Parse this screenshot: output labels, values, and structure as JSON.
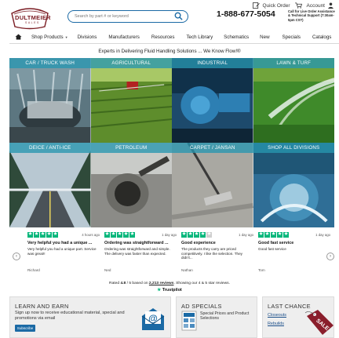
{
  "utility": {
    "quick_order": "Quick Order",
    "account": "Account"
  },
  "brand": {
    "name": "DULTMEIER",
    "sub": "SALES"
  },
  "search": {
    "placeholder": "Search by part # or keyword"
  },
  "phone": {
    "number": "1-888-677-5054",
    "note": "Call for Live Order Assistance & Technical Support (7:30am-5pm CST)"
  },
  "nav": [
    "Shop Products",
    "Divisions",
    "Manufacturers",
    "Resources",
    "Tech Library",
    "Schematics",
    "New",
    "Specials",
    "Catalogs"
  ],
  "tagline": "Experts in Delivering Fluid Handling Solutions ... We Know Flow!®",
  "categories": [
    "CAR / TRUCK WASH",
    "AGRICULTURAL",
    "INDUSTRIAL",
    "LAWN & TURF",
    "DEICE / ANTI-ICE",
    "PETROLEUM",
    "CARPET / JANSAN",
    "SHOP ALL DIVISIONS"
  ],
  "reviews": [
    {
      "stars": 5,
      "date": "4 hours ago",
      "title": "Very helpful you had a unique ...",
      "body": "Very helpful you had a unique part. Service was great!!",
      "name": "Richard"
    },
    {
      "stars": 5,
      "date": "1 day ago",
      "title": "Ordering was straightforward ...",
      "body": "Ordering was straightforward and simple. The delivery was faster than expected.",
      "name": "Ned"
    },
    {
      "stars": 4,
      "date": "1 day ago",
      "title": "Good experience",
      "body": "The products they carry are priced competitively. I like the selection. They didn't...",
      "name": "Nathan"
    },
    {
      "stars": 5,
      "date": "1 day ago",
      "title": "Good fast service",
      "body": "Good fast service",
      "name": "Tom"
    }
  ],
  "rating": {
    "pre": "Rated",
    "score": "4.8",
    "mid": "/ 5 based on",
    "count": "2,213 reviews",
    "post": ". Showing our 4 & 5 star reviews.",
    "brand": "Trustpilot"
  },
  "promos": {
    "learn": {
      "title": "LEARN AND EARN",
      "text": "Sign up now to receive educational material, special and promotions via email",
      "button": "Subscribe"
    },
    "ad": {
      "title": "AD SPECIALS",
      "text": "Special Prices and Product Selections"
    },
    "chance": {
      "title": "LAST CHANCE",
      "links": [
        "Closeouts",
        "Rebuilds"
      ],
      "tag": "SALE"
    }
  },
  "colors": {
    "accent": "#1b6aa5",
    "brand": "#7a1b22",
    "trustpilot": "#00b67a",
    "tile_label": "#2896af"
  }
}
